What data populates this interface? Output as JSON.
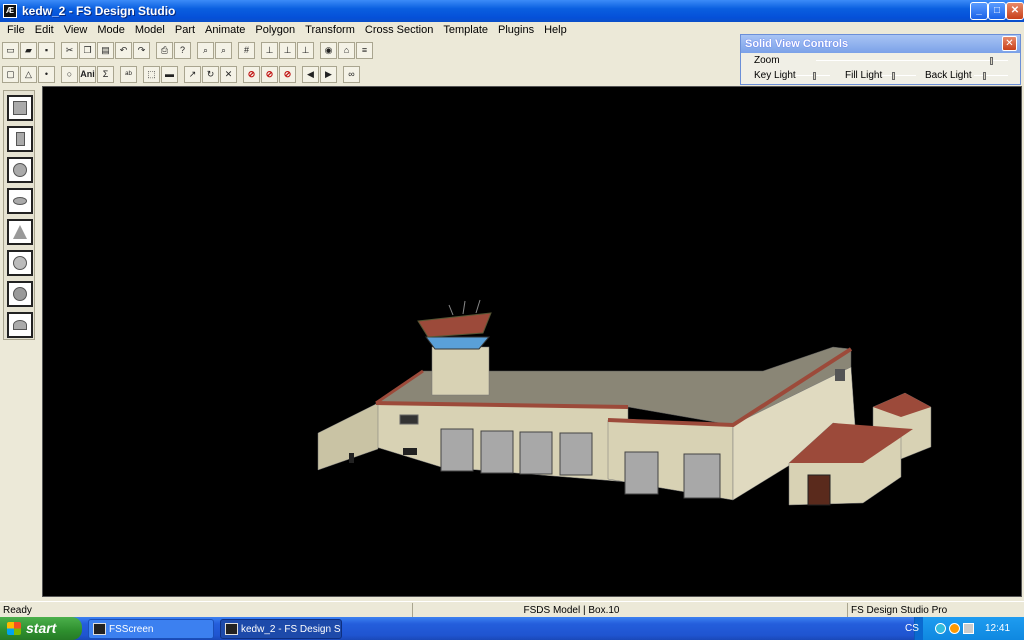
{
  "window": {
    "title": "kedw_2 - FS Design Studio",
    "app_icon": "Æ"
  },
  "menu": [
    "File",
    "Edit",
    "View",
    "Mode",
    "Model",
    "Part",
    "Animate",
    "Polygon",
    "Transform",
    "Cross Section",
    "Template",
    "Plugins",
    "Help"
  ],
  "toolbar_labels": {
    "ani": "Ani",
    "sigma": "Σ"
  },
  "solid_view_controls": {
    "title": "Solid View Controls",
    "zoom_label": "Zoom",
    "key_light_label": "Key Light",
    "fill_light_label": "Fill Light",
    "back_light_label": "Back Light",
    "zoom_value": 0.93,
    "key_light_value": 0.6,
    "fill_light_value": 0.35,
    "back_light_value": 0.3
  },
  "statusbar": {
    "ready": "Ready",
    "model_info": "FSDS Model | Box.10",
    "product": "FS Design Studio Pro"
  },
  "taskbar": {
    "start": "start",
    "task1": "FSScreen",
    "task2": "kedw_2 - FS Design S...",
    "tray_lang": "CS",
    "clock": "12:41"
  },
  "colors": {
    "viewport_bg": "#000000",
    "wall": "#d8d2b4",
    "roof": "#8a8676",
    "trim": "#9c4a3a",
    "tower_glass": "#5aa0d8"
  }
}
